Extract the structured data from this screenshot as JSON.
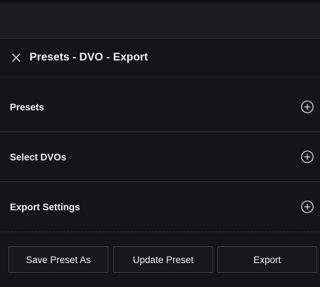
{
  "panel": {
    "title": "Presets - DVO - Export"
  },
  "icons": {
    "close": "close-icon",
    "expand": "plus-circle-icon"
  },
  "sections": [
    {
      "label": "Presets"
    },
    {
      "label": "Select DVOs"
    },
    {
      "label": "Export Settings"
    }
  ],
  "footer": {
    "save_preset_as": "Save Preset As",
    "update_preset": "Update Preset",
    "export": "Export"
  },
  "colors": {
    "background": "#121519",
    "header_band": "#191c21",
    "divider": "#2d3137",
    "text": "#eef1f4",
    "button_border": "#3a3f46"
  }
}
